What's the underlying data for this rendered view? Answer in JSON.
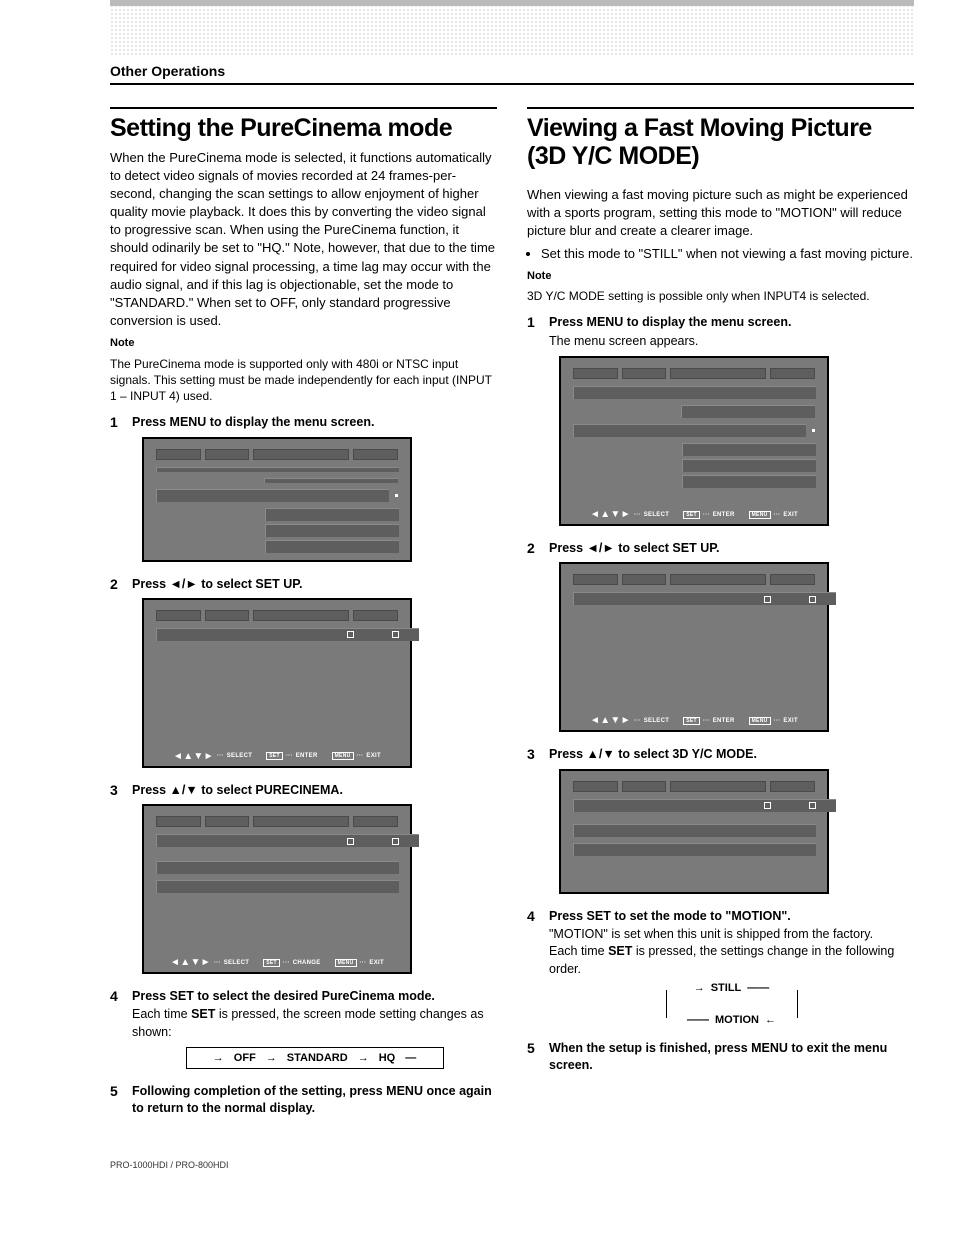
{
  "header": {
    "section": "Other Operations"
  },
  "left": {
    "title": "Setting the PureCinema mode",
    "intro": "When the PureCinema mode is selected, it functions automatically to detect video signals of movies recorded at 24 frames-per-second, changing the scan settings to allow enjoyment of higher quality movie playback. It does this by converting the video signal to progressive scan.  When using the PureCinema function, it should odinarily be set to \"HQ.\" Note, however, that due to the time required for video signal processing, a time lag may occur with the audio signal, and if this lag is objectionable, set the mode to \"STANDARD.\" When set to OFF, only standard progressive conversion is used.",
    "note_head": "Note",
    "note_body": "The PureCinema mode is supported only with 480i or NTSC input signals. This setting must be made independently for each input (INPUT 1 – INPUT 4) used.",
    "steps": [
      {
        "title": "Press MENU to display the menu screen.",
        "body": ""
      },
      {
        "title": "Press ◄/► to select SET UP.",
        "body": ""
      },
      {
        "title": "Press ▲/▼ to select PURECINEMA.",
        "body": ""
      },
      {
        "title": "Press SET to select the desired PureCinema mode.",
        "body_pre": "Each time ",
        "body_bold": "SET",
        "body_post": " is pressed, the screen mode setting changes as shown:"
      },
      {
        "title": "Following  completion of the setting, press MENU once again to return to the normal display.",
        "body": ""
      }
    ],
    "cycle": {
      "a": "OFF",
      "b": "STANDARD",
      "c": "HQ"
    }
  },
  "right": {
    "title": "Viewing a Fast Moving Picture (3D Y/C MODE)",
    "intro": "When viewing a fast moving picture such as might be experienced with a sports program, setting this mode to \"MOTION\" will reduce picture blur and create a clearer image.",
    "bullet": "Set this mode to \"STILL\" when not viewing a fast moving picture.",
    "note_head": "Note",
    "note_body": "3D Y/C MODE setting is possible only when INPUT4 is selected.",
    "steps": [
      {
        "title": "Press MENU to display the menu screen.",
        "body": "The menu screen appears."
      },
      {
        "title": "Press ◄/► to select SET UP.",
        "body": ""
      },
      {
        "title": "Press ▲/▼ to select 3D Y/C MODE.",
        "body": ""
      },
      {
        "title": "Press SET to set the mode to \"MOTION\".",
        "body1": "\"MOTION\" is set when this unit is shipped from the factory.",
        "body2_pre": "Each time ",
        "body2_bold": "SET",
        "body2_post": " is pressed, the settings change in the following order."
      },
      {
        "title": "When the setup is finished, press MENU to exit the menu screen.",
        "body": ""
      }
    ],
    "cycle": {
      "a": "STILL",
      "b": "MOTION"
    }
  },
  "screen_footer": {
    "select": "SELECT",
    "enter": "ENTER",
    "change": "CHANGE",
    "exit": "EXIT",
    "set_btn": "SET",
    "menu_btn": "MENU"
  },
  "footer_model": "PRO-1000HDI / PRO-800HDI"
}
